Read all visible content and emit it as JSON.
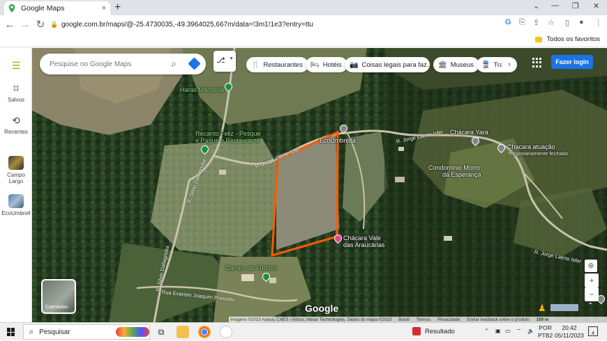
{
  "browser": {
    "tab_title": "Google Maps",
    "tab_close": "×",
    "new_tab": "+",
    "url": "google.com.br/maps/@-25.4730035,-49.3964025,667m/data=!3m1!1e3?entry=ttu",
    "bookmark_folder": "Todos os favoritos",
    "window_controls": {
      "chevron": "⌄",
      "minimize": "—",
      "restore": "❐",
      "close": "✕"
    }
  },
  "rail": {
    "menu_icon": "☰",
    "items": [
      {
        "label": "Salvos",
        "icon": "bookmark-icon"
      },
      {
        "label": "Recentes",
        "icon": "history-icon"
      },
      {
        "label": "Campo Largo",
        "icon": "thumbnail"
      },
      {
        "label": "EcoUmbrell",
        "icon": "thumbnail"
      }
    ]
  },
  "search": {
    "placeholder": "Pesquise no Google Maps"
  },
  "chips": [
    {
      "label": "Restaurantes",
      "icon": "fork-knife-icon"
    },
    {
      "label": "Hotéis",
      "icon": "bed-icon"
    },
    {
      "label": "Coisas legais para faz...",
      "icon": "camera-icon"
    },
    {
      "label": "Museus",
      "icon": "museum-icon"
    },
    {
      "label": "Tran",
      "icon": "transit-icon"
    }
  ],
  "login_label": "Fazer login",
  "places": {
    "haras": "Haras Manoella",
    "recanto_1": "Recanto Feliz - Pesque",
    "recanto_2": "e Pague e Restaurante",
    "ecoumbrella": "EcoUmbrella",
    "chacara_yara": "Chácara Yara",
    "chacara_atuacao": "Chacara atuação",
    "chacara_atuacao_status": "Temporariamente fechado",
    "condominio_1": "Condominio Morro",
    "condominio_2": "da Esperança",
    "chacara_vale_1": "Chácara Vale",
    "chacara_vale_2": "das Araucárias",
    "campo_futebol": "Campo de Futebol"
  },
  "roads": {
    "jorge_1": "R. Jorge Laerte Isfer",
    "jorge_2": "R. Jorge Laerte Isfer",
    "jorge_3": "R. Jorge Laerte Isfer",
    "silvio": "R. Silvio Dallagnolia",
    "silvio_2": "R. Silvio Dallagnolia",
    "evaristo": "Rua Evaristo Joaquim Pressato"
  },
  "map_ui": {
    "layers_label": "Camadas",
    "google_logo": "Google",
    "attribution": "Imagens ©2023 Airbus, CNES / Airbus, Maxar Technologies, Dados do mapa ©2023",
    "brasil": "Brasil",
    "termos": "Termos",
    "privacidade": "Privacidade",
    "feedback": "Enviar feedback sobre o produto",
    "scale": "100 m",
    "zoom_in": "+",
    "zoom_out": "−"
  },
  "taskbar": {
    "search_placeholder": "Pesquisar",
    "result_label": "Resultado",
    "lang_1": "POR",
    "lang_2": "PTB2",
    "time": "20:42",
    "date": "05/11/2023",
    "notifications": "4"
  }
}
